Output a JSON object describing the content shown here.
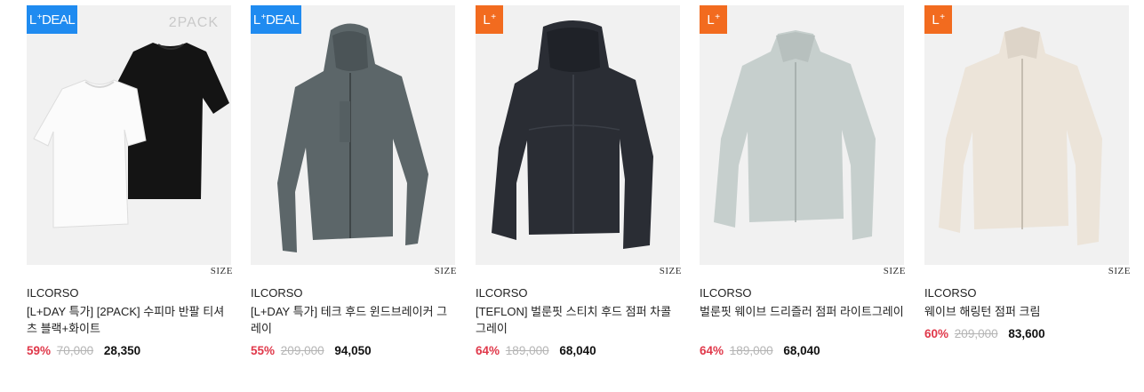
{
  "products": [
    {
      "badge_type": "deal",
      "badge_text": "L+DEAL",
      "pack_label": "2PACK",
      "size_label": "SIZE",
      "brand": "ILCORSO",
      "title": "[L+DAY 특가] [2PACK] 수피마 반팔 티셔츠 블랙+화이트",
      "discount": "59%",
      "original_price": "70,000",
      "sale_price": "28,350",
      "image": "black and white t-shirts"
    },
    {
      "badge_type": "deal",
      "badge_text": "L+DEAL",
      "pack_label": "",
      "size_label": "SIZE",
      "brand": "ILCORSO",
      "title": "[L+DAY 특가] 테크 후드 윈드브레이커 그레이",
      "discount": "55%",
      "original_price": "209,000",
      "sale_price": "94,050",
      "image": "grey hooded windbreaker"
    },
    {
      "badge_type": "plus",
      "badge_text": "L+",
      "pack_label": "",
      "size_label": "SIZE",
      "brand": "ILCORSO",
      "title": "[TEFLON] 벌룬핏 스티치 후드 점퍼 차콜그레이",
      "discount": "64%",
      "original_price": "189,000",
      "sale_price": "68,040",
      "image": "charcoal hooded jumper"
    },
    {
      "badge_type": "plus",
      "badge_text": "L+",
      "pack_label": "",
      "size_label": "SIZE",
      "brand": "ILCORSO",
      "title": "벌룬핏 웨이브 드리즐러 점퍼 라이트그레이",
      "discount": "64%",
      "original_price": "189,000",
      "sale_price": "68,040",
      "image": "light grey drizzler jacket"
    },
    {
      "badge_type": "plus",
      "badge_text": "L+",
      "pack_label": "",
      "size_label": "SIZE",
      "brand": "ILCORSO",
      "title": "웨이브 해링턴 점퍼 크림",
      "discount": "60%",
      "original_price": "209,000",
      "sale_price": "83,600",
      "image": "cream harrington jacket"
    }
  ],
  "colors": {
    "deal_badge": "#1f8bf0",
    "plus_badge": "#f26b1f",
    "discount": "#e0384a",
    "thumb_bg": "#f1f1f1"
  }
}
